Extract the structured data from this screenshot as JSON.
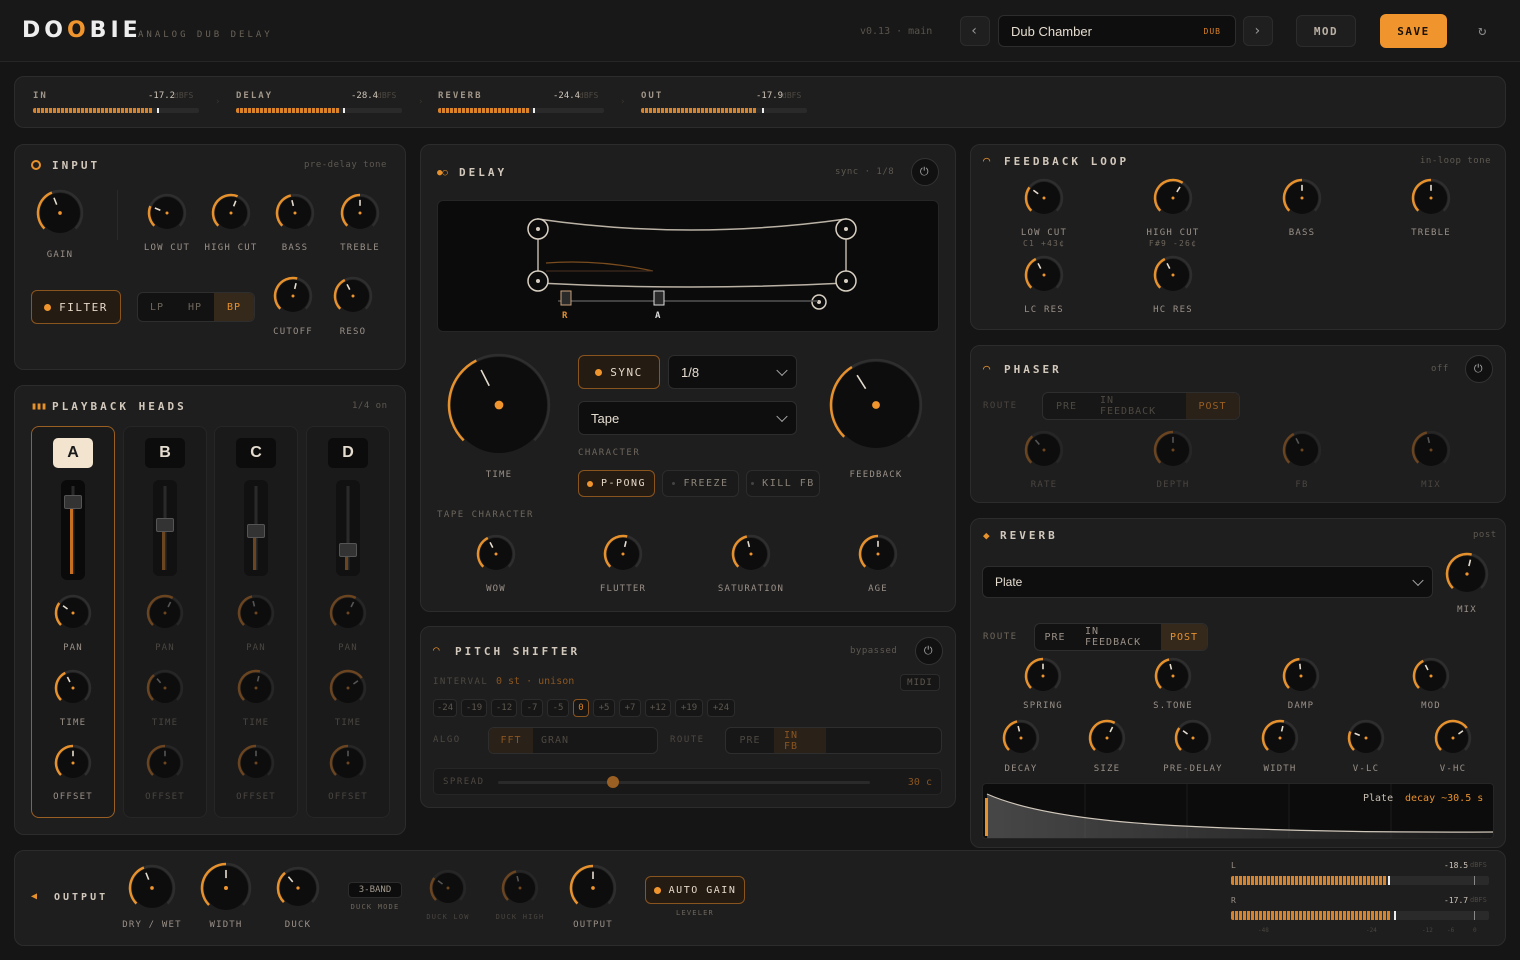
{
  "app": {
    "logo": "DOOBIE",
    "subtitle": "ANALOG DUB DELAY",
    "version": "v0.13 · main"
  },
  "preset": {
    "name": "Dub Chamber",
    "tag": "DUB"
  },
  "header": {
    "mod_label": "MOD",
    "save_label": "SAVE",
    "accent": "#f0952e"
  },
  "meters": [
    {
      "label": "IN",
      "value": "-17.2",
      "unit": "dBFS",
      "level": 0.72
    },
    {
      "label": "DELAY",
      "value": "-28.4",
      "unit": "dBFS",
      "level": 0.62
    },
    {
      "label": "REVERB",
      "value": "-24.4",
      "unit": "dBFS",
      "level": 0.55
    },
    {
      "label": "OUT",
      "value": "-17.9",
      "unit": "dBFS",
      "level": 0.7
    }
  ],
  "input": {
    "title": "INPUT",
    "note": "pre-delay tone",
    "knobs": [
      "GAIN",
      "LOW CUT",
      "HIGH CUT",
      "BASS",
      "TREBLE",
      "CUTOFF",
      "RESO"
    ],
    "filter_label": "FILTER",
    "modes": [
      "LP",
      "HP",
      "BP"
    ],
    "mode_selected": "BP"
  },
  "heads": {
    "title": "PLAYBACK HEADS",
    "note": "1/4 on",
    "names": [
      "A",
      "B",
      "C",
      "D"
    ],
    "selected": "A",
    "labels": {
      "pan": "PAN",
      "time": "TIME",
      "offset": "OFFSET"
    },
    "levels": [
      0.9,
      0.62,
      0.55,
      0.32
    ]
  },
  "delay": {
    "title": "DELAY",
    "note": "sync · 1/8",
    "time_label": "TIME",
    "feedback_label": "FEEDBACK",
    "sync_label": "SYNC",
    "division": "1/8",
    "tape": "Tape",
    "character_label": "CHARACTER",
    "character": [
      "P-PONG",
      "FREEZE",
      "KILL FB"
    ],
    "tape_character_label": "TAPE CHARACTER",
    "tape_knobs": [
      "WOW",
      "FLUTTER",
      "SATURATION",
      "AGE"
    ],
    "head_markers": [
      "R",
      "A"
    ]
  },
  "pitch": {
    "title": "PITCH SHIFTER",
    "note": "bypassed",
    "interval_label": "INTERVAL",
    "interval_value": "0 st · unison",
    "midi": "MIDI",
    "intervals": [
      "-24",
      "-19",
      "-12",
      "-7",
      "-5",
      "0",
      "+5",
      "+7",
      "+12",
      "+19",
      "+24"
    ],
    "interval_selected": "0",
    "algo_label": "ALGO",
    "algos": [
      "FFT",
      "GRAN"
    ],
    "route_label": "ROUTE",
    "routes": [
      "PRE",
      "IN FB"
    ],
    "spread_label": "SPREAD",
    "spread_value": "30 c",
    "spread_level": 0.31
  },
  "feedback": {
    "title": "FEEDBACK LOOP",
    "note": "in-loop tone",
    "knobs": [
      {
        "label": "LOW CUT",
        "sub": "C1 +43¢"
      },
      {
        "label": "HIGH CUT",
        "sub": "F#9 -26¢"
      },
      {
        "label": "BASS",
        "sub": ""
      },
      {
        "label": "TREBLE",
        "sub": ""
      },
      {
        "label": "LC RES",
        "sub": ""
      },
      {
        "label": "HC RES",
        "sub": ""
      }
    ]
  },
  "phaser": {
    "title": "PHASER",
    "note": "off",
    "route_label": "ROUTE",
    "routes": [
      "PRE",
      "IN FEEDBACK",
      "POST"
    ],
    "route_selected": "POST",
    "knobs": [
      "RATE",
      "DEPTH",
      "FB",
      "MIX"
    ]
  },
  "reverb": {
    "title": "REVERB",
    "note": "post",
    "type": "Plate",
    "mix_label": "MIX",
    "route_label": "ROUTE",
    "routes": [
      "PRE",
      "IN FEEDBACK",
      "POST"
    ],
    "route_selected": "POST",
    "knobs1": [
      "SPRING",
      "S.TONE",
      "DAMP",
      "MOD"
    ],
    "knobs2": [
      "DECAY",
      "SIZE",
      "PRE-DELAY",
      "WIDTH",
      "V-LC",
      "V-HC"
    ],
    "graph_name": "Plate",
    "graph_decay": "decay ~30.5 s"
  },
  "output": {
    "title": "OUTPUT",
    "dry_wet": "DRY / WET",
    "width": "WIDTH",
    "duck": "DUCK",
    "duck_mode_value": "3-BAND",
    "duck_mode_label": "DUCK MODE",
    "duck_low": "DUCK LOW",
    "duck_high": "DUCK HIGH",
    "output": "OUTPUT",
    "auto_gain": "AUTO GAIN",
    "leveler": "LEVELER",
    "meter_l": {
      "ch": "L",
      "value": "-18.5",
      "unit": "dBFS",
      "level": 0.6
    },
    "meter_r": {
      "ch": "R",
      "value": "-17.7",
      "unit": "dBFS",
      "level": 0.62
    },
    "scale": [
      "-48",
      "-24",
      "-12",
      "-6",
      "0"
    ]
  }
}
